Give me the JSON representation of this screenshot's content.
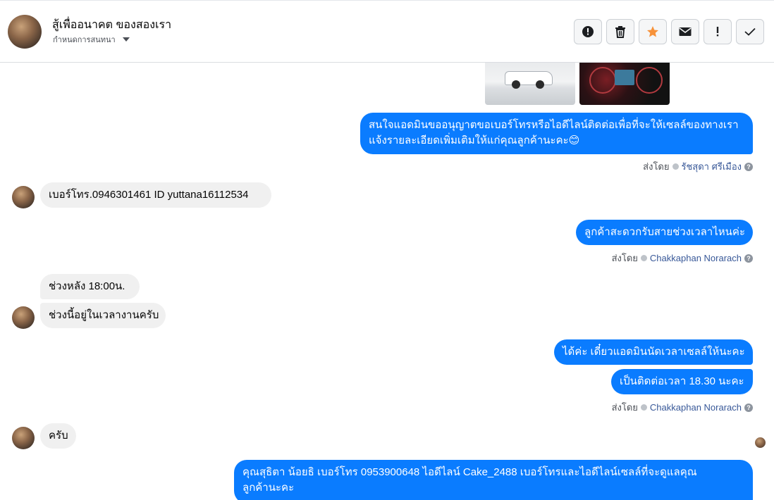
{
  "header": {
    "title": "สู้เพื่ออนาคต ของสองเรา",
    "subtitle": "กำหนดการสนทนา",
    "toolbar": [
      {
        "name": "report-icon",
        "glyph": "!"
      },
      {
        "name": "trash-icon",
        "glyph": "🗑"
      },
      {
        "name": "star-icon",
        "glyph": "★"
      },
      {
        "name": "mail-icon",
        "glyph": "✉"
      },
      {
        "name": "exclamation-icon",
        "glyph": "!"
      },
      {
        "name": "check-icon",
        "glyph": "✓"
      }
    ],
    "accent_star": "#f7923a"
  },
  "messages": [
    {
      "id": "m1",
      "dir": "out",
      "lines": [
        "สนใจแอดมินขออนุญาตขอเบอร์โทรหรือไอดีไลน์ติดต่อเพื่อที่จะให้เซลล์ของทางเรา",
        "แจ้งรายละเอียดเพิ่มเติมให้แก่คุณลูกค้านะคะ😊"
      ]
    },
    {
      "id": "s1",
      "sent_label": "ส่งโดย",
      "sender": "รัชสุดา ศรีเมือง"
    },
    {
      "id": "m2",
      "dir": "in",
      "text": "เบอร์โทร.0946301461  ID yuttana16112534"
    },
    {
      "id": "m3",
      "dir": "out",
      "text": "ลูกค้าสะดวกรับสายช่วงเวลาไหนค่ะ"
    },
    {
      "id": "s2",
      "sent_label": "ส่งโดย",
      "sender": "Chakkaphan Norarach"
    },
    {
      "id": "m4",
      "dir": "in",
      "text": "ช่วงหลัง  18:00น."
    },
    {
      "id": "m5",
      "dir": "in",
      "text": "ช่วงนี้อยู่ในเวลางานครับ"
    },
    {
      "id": "m6",
      "dir": "out",
      "text": "ได้ค่ะ เดี๋ยวแอดมินนัดเวลาเซลล์ให้นะคะ"
    },
    {
      "id": "m7",
      "dir": "out",
      "text": "เป็นติดต่อเวลา 18.30 นะคะ"
    },
    {
      "id": "s3",
      "sent_label": "ส่งโดย",
      "sender": "Chakkaphan Norarach"
    },
    {
      "id": "m8",
      "dir": "in",
      "text": "ครับ"
    },
    {
      "id": "m9",
      "dir": "out",
      "lines": [
        "คุณสุธิตา น้อยธิ      เบอร์โทร 0953900648  ไอดีไลน์ Cake_2488   เบอร์โทรและไอดีไลน์เซลล์ที่จะดูแลคุณ",
        "ลูกค้านะคะ"
      ]
    }
  ],
  "colors": {
    "outgoing": "#0a7cff",
    "incoming": "#f0f0f0"
  }
}
